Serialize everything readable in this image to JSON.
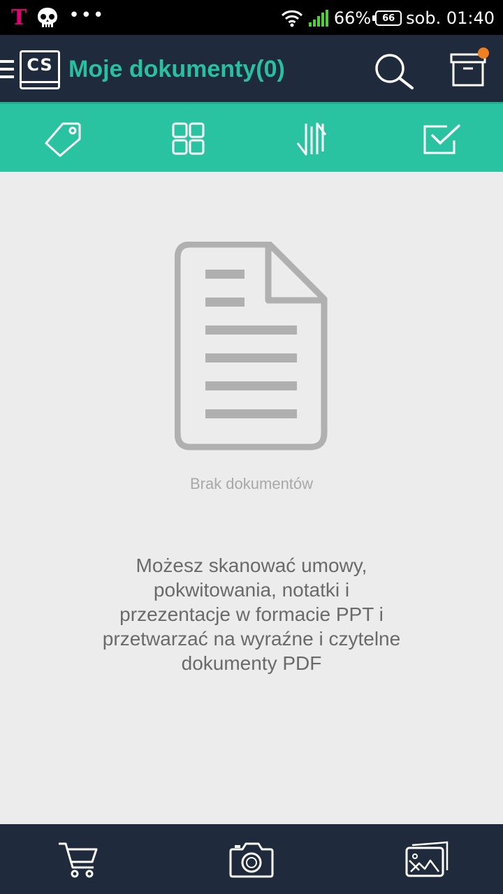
{
  "status_bar": {
    "carrier_logo": "T",
    "battery_percent": "66%",
    "battery_level": "66",
    "clock": "sob. 01:40",
    "icons": [
      "t-mobile-icon",
      "skull-icon",
      "more-dots-icon",
      "wifi-icon",
      "signal-icon",
      "battery-icon"
    ]
  },
  "app_bar": {
    "logo_text": "CS",
    "title": "Moje dokumenty(0)",
    "accent_color": "#27c1a0",
    "notification_color": "#f08020",
    "icons": [
      "menu-icon",
      "search-icon",
      "archive-box-icon"
    ]
  },
  "toolbar": {
    "background": "#2ac3a2",
    "icons": [
      "tag-icon",
      "grid-view-icon",
      "sort-icon",
      "select-check-icon"
    ]
  },
  "empty_state": {
    "icon": "document-icon",
    "title": "Brak dokumentów",
    "description_lines": [
      "Możesz skanować umowy,",
      "pokwitowania, notatki i",
      "przezentacje w formacie PPT i",
      "przetwarzać na wyraźne i czytelne",
      "dokumenty PDF"
    ]
  },
  "bottom_bar": {
    "icons": [
      "cart-icon",
      "camera-icon",
      "gallery-import-icon"
    ]
  }
}
